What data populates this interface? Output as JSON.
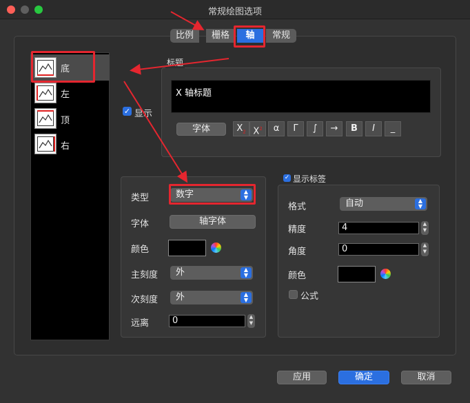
{
  "window": {
    "title": "常规绘图选项"
  },
  "tabs": [
    {
      "label": "比例"
    },
    {
      "label": "栅格"
    },
    {
      "label": "轴"
    },
    {
      "label": "常规"
    }
  ],
  "axis_list": [
    {
      "label": "底",
      "selected": true
    },
    {
      "label": "左",
      "selected": false
    },
    {
      "label": "顶",
      "selected": false
    },
    {
      "label": "右",
      "selected": false
    }
  ],
  "title_section": {
    "group_label": "标题",
    "show_label": "显示",
    "show_checked": true,
    "text": "X 轴标题",
    "font_button": "字体",
    "symbols": [
      "X",
      "X",
      "α",
      "Γ",
      "∫",
      "→",
      "B",
      "I",
      "_"
    ]
  },
  "axis_props": {
    "type_label": "类型",
    "type_value": "数字",
    "font_label": "字体",
    "font_button": "轴字体",
    "color_label": "颜色",
    "major_tick_label": "主刻度",
    "major_tick_value": "外",
    "minor_tick_label": "次刻度",
    "minor_tick_value": "外",
    "distance_label": "远离",
    "distance_value": "0"
  },
  "tick_labels": {
    "show_label": "显示标签",
    "show_checked": true,
    "format_label": "格式",
    "format_value": "自动",
    "precision_label": "精度",
    "precision_value": "4",
    "angle_label": "角度",
    "angle_value": "0",
    "color_label": "颜色",
    "formula_label": "公式",
    "formula_checked": false
  },
  "footer": {
    "apply": "应用",
    "ok": "确定",
    "cancel": "取消"
  },
  "colors": {
    "accent": "#2b6fe0",
    "highlight": "#e5262f"
  }
}
